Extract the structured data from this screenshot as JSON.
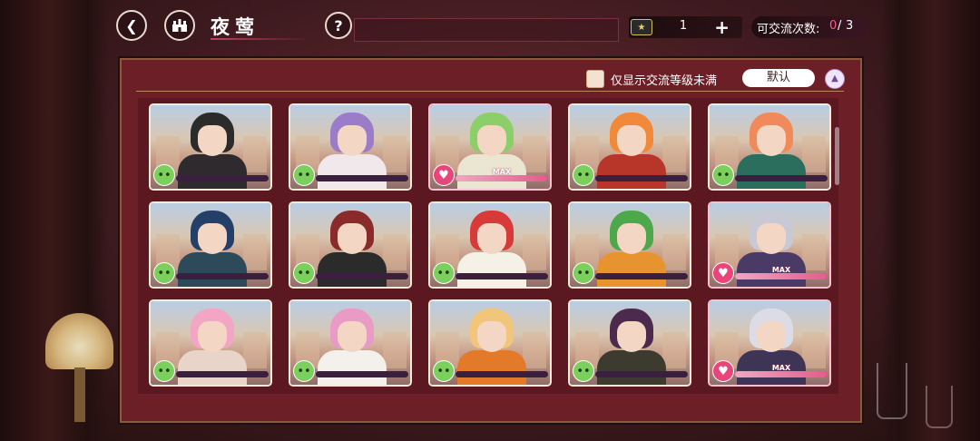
{
  "header": {
    "title": "夜莺",
    "ticket_count": "1",
    "add_label": "+",
    "exchange_label": "可交流次数:",
    "exchange_current": "0",
    "exchange_sep": "/",
    "exchange_max": "3"
  },
  "toolbar": {
    "filter_label": "仅显示交流等级未满",
    "sort_label": "默认"
  },
  "characters": [
    {
      "status": "neutral",
      "max": false,
      "hair": "#2b2b2b",
      "outfit": "#2e2a2e"
    },
    {
      "status": "neutral",
      "max": false,
      "hair": "#9b7cc9",
      "outfit": "#f0e8ea"
    },
    {
      "status": "love",
      "max": true,
      "max_text": "MAX",
      "hair": "#8ccf6a",
      "outfit": "#eae6d2"
    },
    {
      "status": "neutral",
      "max": false,
      "hair": "#f08a3a",
      "outfit": "#b8352a"
    },
    {
      "status": "neutral",
      "max": false,
      "hair": "#f08a5a",
      "outfit": "#2c6e5e"
    },
    {
      "status": "neutral",
      "max": false,
      "hair": "#254068",
      "outfit": "#2d4a5a"
    },
    {
      "status": "neutral",
      "max": false,
      "hair": "#8a2a2a",
      "outfit": "#2b2b2b"
    },
    {
      "status": "neutral",
      "max": false,
      "hair": "#d83a3a",
      "outfit": "#f6f1e6"
    },
    {
      "status": "neutral",
      "max": false,
      "hair": "#4ca84a",
      "outfit": "#e7932f"
    },
    {
      "status": "love",
      "max": true,
      "max_text": "MAX",
      "hair": "#c9c9d6",
      "outfit": "#4a3a66"
    },
    {
      "status": "neutral",
      "max": false,
      "hair": "#f2a6c4",
      "outfit": "#e8d4c8"
    },
    {
      "status": "neutral",
      "max": false,
      "hair": "#e99bc6",
      "outfit": "#f4f1ec"
    },
    {
      "status": "neutral",
      "max": false,
      "hair": "#f2c67a",
      "outfit": "#e37a2a"
    },
    {
      "status": "neutral",
      "max": false,
      "hair": "#4c2a4e",
      "outfit": "#3d3a30"
    },
    {
      "status": "love",
      "max": true,
      "max_text": "MAX",
      "hair": "#dcdce6",
      "outfit": "#3e3556"
    }
  ],
  "icons": {
    "back": "back-arrow-icon",
    "home": "castle-home-icon",
    "help": "question-icon",
    "ticket": "ticket-icon",
    "neutral": "neutral-face-icon",
    "love": "heart-face-icon",
    "sort": "sort-toggle-icon"
  }
}
